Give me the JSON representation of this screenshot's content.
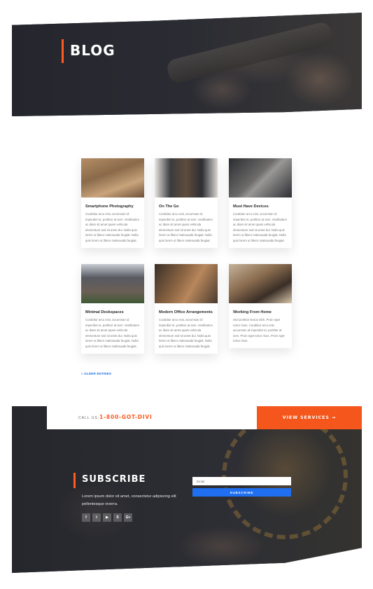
{
  "hero": {
    "title": "BLOG"
  },
  "posts": [
    {
      "title": "Smartphone Photography",
      "excerpt": "Curabitur arcu erat, accumsan id imperdiet et, porttitor at sem. Vestibulum ac diam sit amet quam vehicula elementum sed sit amet dui. Nulla quis lorem ut libero malesuada feugiat. Nulla quis lorem ut libero malesuada feugiat."
    },
    {
      "title": "On The Go",
      "excerpt": "Curabitur arcu erat, accumsan id imperdiet et, porttitor at sem. Vestibulum ac diam sit amet quam vehicula elementum sed sit amet dui. Nulla quis lorem ut libero malesuada feugiat. Nulla quis lorem ut libero malesuada feugiat."
    },
    {
      "title": "Must Have Devices",
      "excerpt": "Curabitur arcu erat, accumsan id imperdiet et, porttitor at sem. Vestibulum ac diam sit amet quam vehicula elementum sed sit amet dui. Nulla quis lorem ut libero malesuada feugiat. Nulla quis lorem ut libero malesuada feugiat."
    },
    {
      "title": "Minimal Deskspaces",
      "excerpt": "Curabitur arcu erat, accumsan id imperdiet et, porttitor at sem. Vestibulum ac diam sit amet quam vehicula elementum sed sit amet dui. Nulla quis lorem ut libero malesuada feugiat. Nulla quis lorem ut libero malesuada feugiat."
    },
    {
      "title": "Modern Office Arrangements",
      "excerpt": "Curabitur arcu erat, accumsan id imperdiet et, porttitor at sem. Vestibulum ac diam sit amet quam vehicula elementum sed sit amet dui. Nulla quis lorem ut libero malesuada feugiat. Nulla quis lorem ut libero malesuada feugiat."
    },
    {
      "title": "Working From Home",
      "excerpt": "Sed porttitor lectus nibh. Proin eget tortor risus. Curabitur arcu erat, accumsan id imperdiet et, porttitor at sem. Proin eget tortor risus. Proin eget tortor risus."
    }
  ],
  "pagination": {
    "older_label": "« OLDER ENTRIES"
  },
  "cta": {
    "call_label": "CALL US:",
    "phone": "1-800-GOT-DIVI",
    "services_label": "VIEW SERVICES →"
  },
  "subscribe": {
    "title": "SUBSCRIBE",
    "text": "Lorem ipsum dolor sit amet, consectetur adipiscing elit pellentesque viverra.",
    "email_placeholder": "Email",
    "button_label": "SUBSCRIBE",
    "socials": [
      {
        "icon": "facebook-icon",
        "glyph": "f"
      },
      {
        "icon": "twitter-icon",
        "glyph": "t"
      },
      {
        "icon": "youtube-icon",
        "glyph": "▶"
      },
      {
        "icon": "skype-icon",
        "glyph": "S"
      },
      {
        "icon": "google-plus-icon",
        "glyph": "G+"
      }
    ]
  },
  "colors": {
    "accent": "#ff5a1f",
    "button_blue": "#1f6ff0",
    "dark_bg": "#23242b"
  }
}
